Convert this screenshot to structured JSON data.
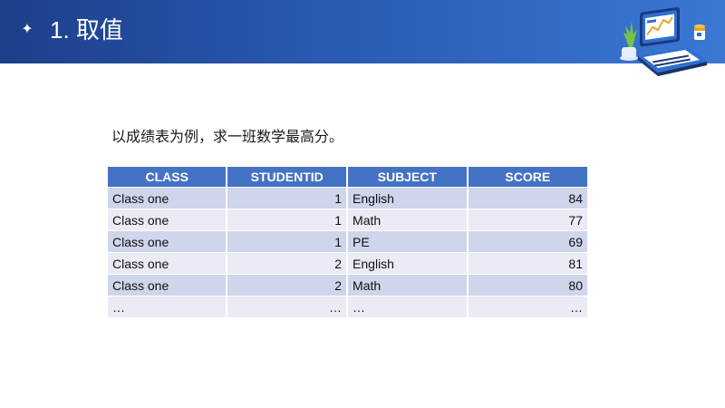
{
  "header": {
    "title": "1. 取值",
    "bullet_icon": "sparkle-star",
    "illustration": "laptop-with-plant-and-coffee",
    "colors": {
      "gradient_start": "#1d3f8a",
      "gradient_end": "#3a78d4"
    }
  },
  "content": {
    "intro": "以成绩表为例，求一班数学最高分。"
  },
  "table": {
    "columns": [
      "CLASS",
      "STUDENTID",
      "SUBJECT",
      "SCORE"
    ],
    "rows": [
      [
        "Class one",
        "1",
        "English",
        "84"
      ],
      [
        "Class one",
        "1",
        "Math",
        "77"
      ],
      [
        "Class one",
        "1",
        "PE",
        "69"
      ],
      [
        "Class one",
        "2",
        "English",
        "81"
      ],
      [
        "Class one",
        "2",
        "Math",
        "80"
      ],
      [
        "…",
        "…",
        "…",
        "…"
      ]
    ],
    "colors": {
      "header_bg": "#4472c4",
      "row_odd": "#cfd5ea",
      "row_even": "#e9ebf5"
    }
  }
}
